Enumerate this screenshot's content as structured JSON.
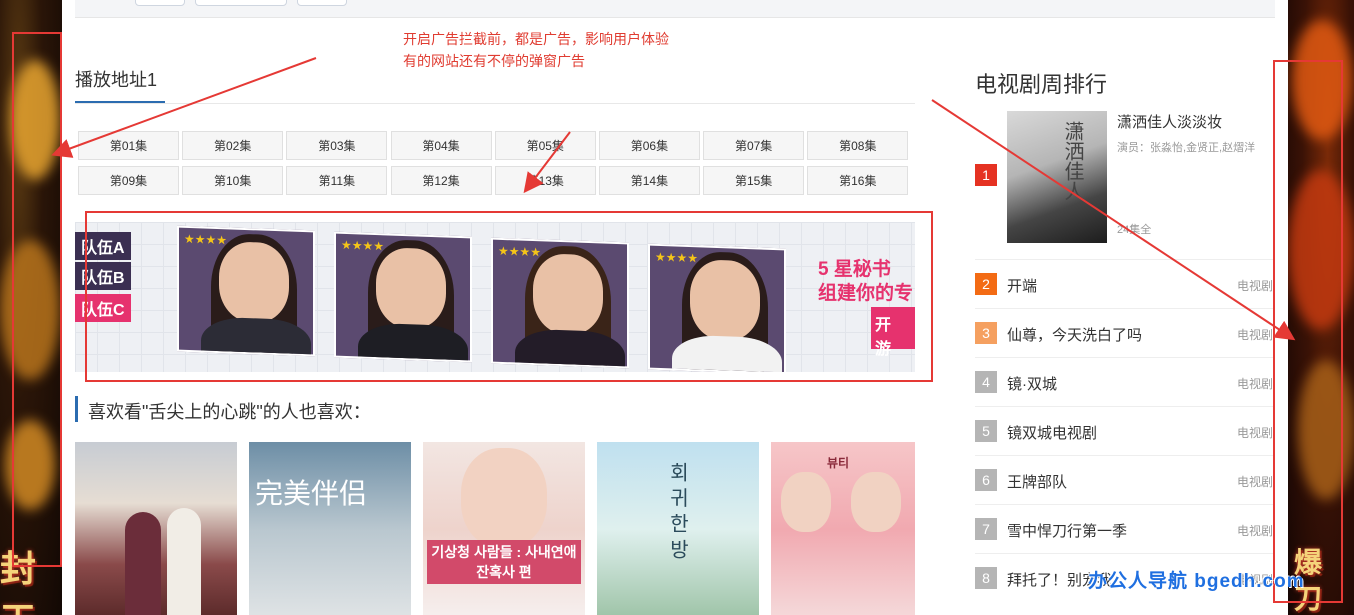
{
  "annotation": {
    "line1": "开启广告拦截前，都是广告，影响用户体验",
    "line2": "有的网站还有不停的弹窗广告"
  },
  "side_ads": {
    "left_text": "封天",
    "right_text": "爆 刀"
  },
  "play": {
    "title": "播放地址1",
    "episodes": [
      "第01集",
      "第02集",
      "第03集",
      "第04集",
      "第05集",
      "第06集",
      "第07集",
      "第08集",
      "第09集",
      "第10集",
      "第11集",
      "第12集",
      "第13集",
      "第14集",
      "第15集",
      "第16集"
    ]
  },
  "banner_ad": {
    "team_a": "队伍A",
    "team_b": "队伍B",
    "team_c": "队伍C",
    "slogan_1": "5 星秘书",
    "slogan_2": "组建你的专",
    "button": "开 游"
  },
  "recommend": {
    "title": "喜欢看\"舌尖上的心跳\"的人也喜欢：",
    "poster_2_caption": "完美伴侣",
    "poster_3_caption": "기상청 사람들 : 사내연애 잔혹사 편",
    "poster_4_caption": "회 귀 한 방",
    "poster_5_caption": "뷰티"
  },
  "rank": {
    "title": "电视剧周排行",
    "top": {
      "num": "1",
      "name": "潇洒佳人淡淡妆",
      "cast": "演员：张淼怡,金贤正,赵熠洋",
      "eps": "24集全",
      "poster_caption": "潇洒佳人"
    },
    "items": [
      {
        "num": "2",
        "name": "开端",
        "tag": "电视剧"
      },
      {
        "num": "3",
        "name": "仙尊，今天洗白了吗",
        "tag": "电视剧"
      },
      {
        "num": "4",
        "name": "镜·双城",
        "tag": "电视剧"
      },
      {
        "num": "5",
        "name": "镜双城电视剧",
        "tag": "电视剧"
      },
      {
        "num": "6",
        "name": "王牌部队",
        "tag": "电视剧"
      },
      {
        "num": "7",
        "name": "雪中悍刀行第一季",
        "tag": "电视剧"
      },
      {
        "num": "8",
        "name": "拜托了！别宠我",
        "tag": "电视剧"
      }
    ]
  },
  "watermark": "办公人导航  bgedh.com",
  "colors": {
    "accent": "#2b6cb0",
    "rank1": "#e53222",
    "rank2": "#f36b14",
    "rank3": "#f5a060",
    "rank_other": "#b5b5b5",
    "annotation_red": "#e53935"
  }
}
